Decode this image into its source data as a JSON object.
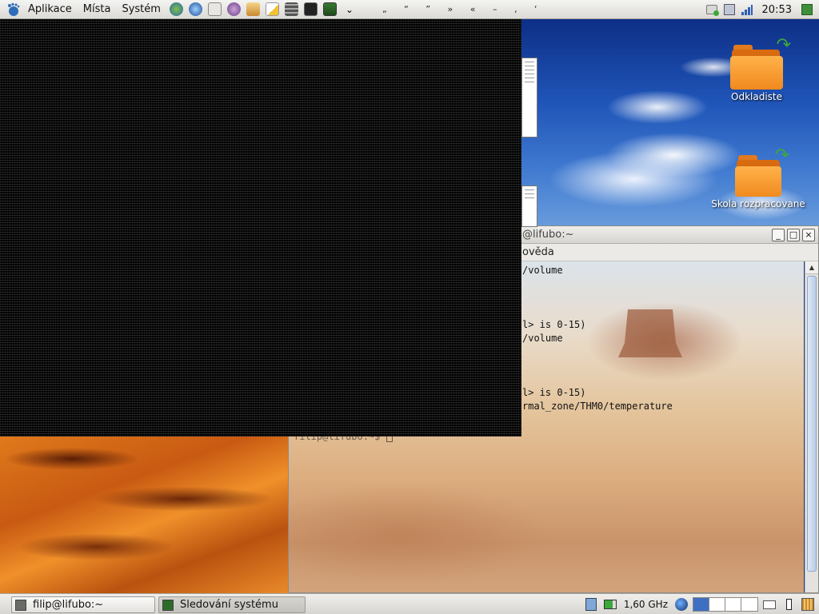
{
  "top_panel": {
    "menus": [
      "Aplikace",
      "Místa",
      "Systém"
    ],
    "launchers": [
      "network-icon",
      "web-browser-icon",
      "home-folder-icon",
      "instant-messenger-icon",
      "image-viewer-icon",
      "text-editor-icon",
      "calculator-icon",
      "terminal-icon",
      "system-monitor-icon"
    ],
    "special_chars": "„ “ ” » « – ‚ ‘",
    "clock": "20:53"
  },
  "desktop": {
    "icons": [
      {
        "label": "Odkladiste"
      },
      {
        "label": "Skola rozpracovane"
      }
    ]
  },
  "terminal": {
    "title": "@lifubo:~",
    "menu_fragment": "ověda",
    "lines": [
      "/volume",
      "l> is 0-15)",
      "/volume",
      "l> is 0-15)",
      "rmal_zone/THM0/temperature"
    ],
    "prompt": "filip@lifubo:~$",
    "window_buttons": {
      "minimize": "_",
      "maximize": "□",
      "close": "×"
    }
  },
  "bottom_panel": {
    "tasks": [
      {
        "label": "filip@lifubo:~"
      },
      {
        "label": "Sledování systému"
      }
    ],
    "cpu_freq": "1,60 GHz"
  },
  "colors": {
    "panel_bg": "#dcdad5",
    "overlay_bg": "#000000",
    "sky_blue": "#1f55b8",
    "folder_orange": "#f08a1e"
  }
}
